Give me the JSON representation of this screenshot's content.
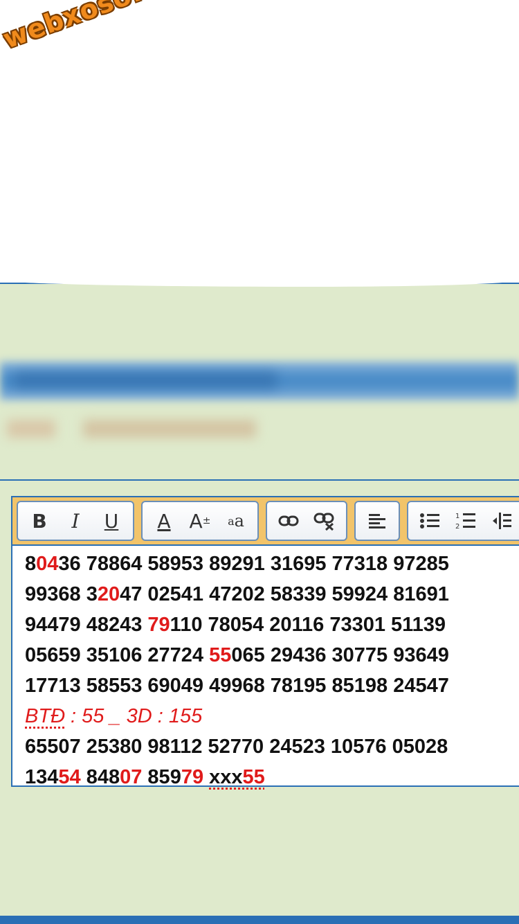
{
  "watermark": "webxoso.net",
  "toolbar": {
    "bold": "B",
    "italic": "I",
    "underline": "U",
    "font_color": "A",
    "font_size": "A",
    "font_size_sup": "±",
    "font_family_a": "a",
    "font_family_b": "a"
  },
  "colors": {
    "highlight": "#e01b1b",
    "accent": "#2a6fb5",
    "toolbar_bg": "#f2c46a"
  },
  "lines": [
    [
      {
        "t": "8"
      },
      {
        "t": "04",
        "h": true
      },
      {
        "t": "36 78864 58953 89291 31695 77318 97285"
      }
    ],
    [
      {
        "t": "99368 3"
      },
      {
        "t": "20",
        "h": true
      },
      {
        "t": "47 02541 47202 58339 59924 81691"
      }
    ],
    [
      {
        "t": "94479 48243 "
      },
      {
        "t": "79",
        "h": true
      },
      {
        "t": "110 78054 20116 73301 51139"
      }
    ],
    [
      {
        "t": "05659 35106 27724 "
      },
      {
        "t": "55",
        "h": true
      },
      {
        "t": "065 29436 30775 93649"
      }
    ],
    [
      {
        "t": "17713 58553 69049 49968 78195 85198 24547"
      }
    ],
    [
      {
        "t": "65507 25380 98112 52770 24523 10576 05028"
      }
    ],
    [
      {
        "t": "134"
      },
      {
        "t": "54",
        "h": true
      },
      {
        "t": " 848"
      },
      {
        "t": "07",
        "h": true
      },
      {
        "t": " 859"
      },
      {
        "t": "79",
        "h": true
      },
      {
        "t": " "
      },
      {
        "t": "xxx",
        "u": true
      },
      {
        "t": "55",
        "h": true,
        "u": true
      }
    ]
  ],
  "btd": {
    "label": "BTĐ",
    "rest": " :  55 _ 3D : 155"
  }
}
